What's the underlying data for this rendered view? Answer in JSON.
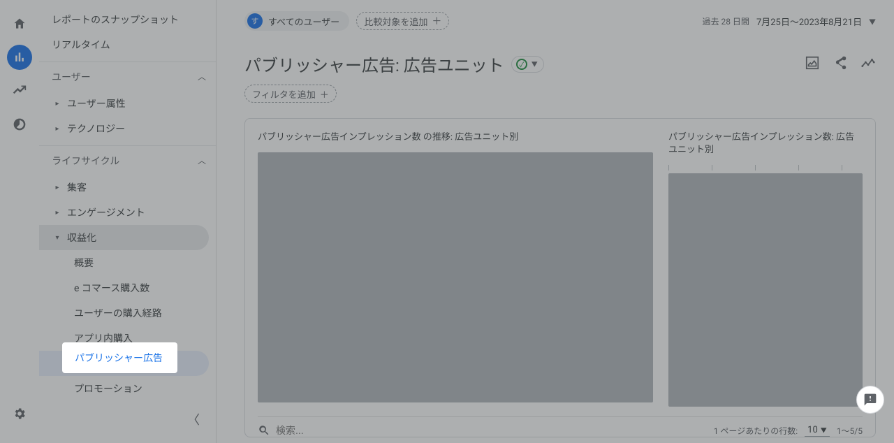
{
  "rail": {
    "icons": [
      "home",
      "reports",
      "explore",
      "advertising",
      "settings"
    ]
  },
  "sidebar": {
    "top_items": [
      "レポートのスナップショット",
      "リアルタイム"
    ],
    "sections": [
      {
        "title": "ユーザー",
        "items": [
          {
            "label": "ユーザー属性"
          },
          {
            "label": "テクノロジー"
          }
        ]
      },
      {
        "title": "ライフサイクル",
        "items": [
          {
            "label": "集客"
          },
          {
            "label": "エンゲージメント"
          },
          {
            "label": "収益化",
            "expanded": true,
            "children": [
              "概要",
              "e コマース購入数",
              "ユーザーの購入経路",
              "アプリ内購入",
              "パブリッシャー広告",
              "プロモーション"
            ],
            "active_child_index": 4
          }
        ]
      }
    ]
  },
  "header": {
    "all_users_badge": "す",
    "all_users_label": "すべてのユーザー",
    "compare_label": "比較対象を追加",
    "date_label": "過去 28 日間",
    "date_range": "7月25日～2023年8月21日"
  },
  "page": {
    "title": "パブリッシャー広告: 広告ユニット",
    "filter_label": "フィルタを追加"
  },
  "charts": {
    "left_title": "パブリッシャー広告インプレッション数 の推移: 広告ユニット別",
    "right_title": "パブリッシャー広告インプレッション数: 広告ユニット別"
  },
  "table": {
    "search_placeholder": "検索...",
    "rows_label": "1 ページあたりの行数:",
    "rows_value": "10",
    "range": "1～5/5"
  },
  "highlight_text": "パブリッシャー広告",
  "chart_data": {
    "type": "bar",
    "note": "Chart areas are placeholder/empty in screenshot; no data points visible.",
    "series": []
  }
}
